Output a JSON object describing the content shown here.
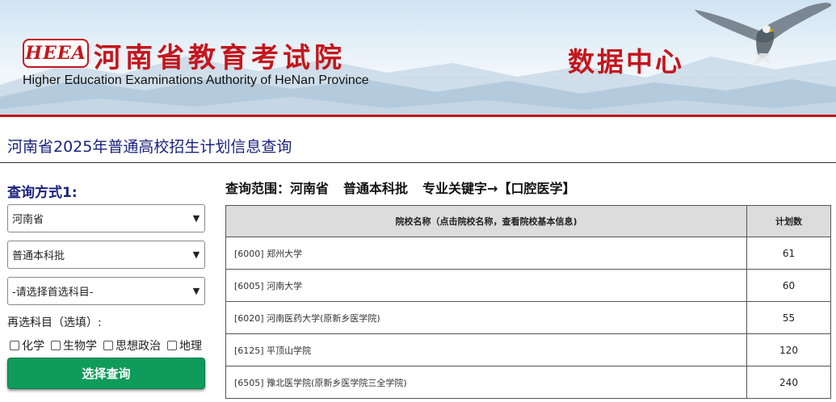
{
  "header": {
    "logo_text": "HEEA",
    "org_name_cn": "河南省教育考试院",
    "org_name_en": "Higher Education Examinations Authority of HeNan Province",
    "section_title": "数据中心"
  },
  "page_title": "河南省2025年普通高校招生计划信息查询",
  "query_form": {
    "label": "查询方式1:",
    "province_select": "河南省",
    "batch_select": "普通本科批",
    "first_subject_select": "-请选择首选科目-",
    "elective_label": "再选科目（选填）:",
    "elective_options": [
      "化学",
      "生物学",
      "思想政治",
      "地理"
    ],
    "submit_label": "选择查询"
  },
  "results": {
    "scope_prefix": "查询范围：河南省",
    "scope_batch": "普通本科批",
    "scope_keyword": "专业关键字→【口腔医学】",
    "columns": [
      "院校名称（点击院校名称，查看院校基本信息)",
      "计划数"
    ],
    "rows": [
      {
        "school": "[6000] 郑州大学",
        "count": "61"
      },
      {
        "school": "[6005] 河南大学",
        "count": "60"
      },
      {
        "school": "[6020] 河南医药大学(原新乡医学院)",
        "count": "55"
      },
      {
        "school": "[6125] 平顶山学院",
        "count": "120"
      },
      {
        "school": "[6505] 豫北医学院(原新乡医学院三全学院)",
        "count": "240"
      }
    ]
  },
  "colors": {
    "brand_red": "#c4161c",
    "title_navy": "#1a237e",
    "button_green": "#0f9b5a",
    "table_header_gray": "#dcdcdc"
  }
}
